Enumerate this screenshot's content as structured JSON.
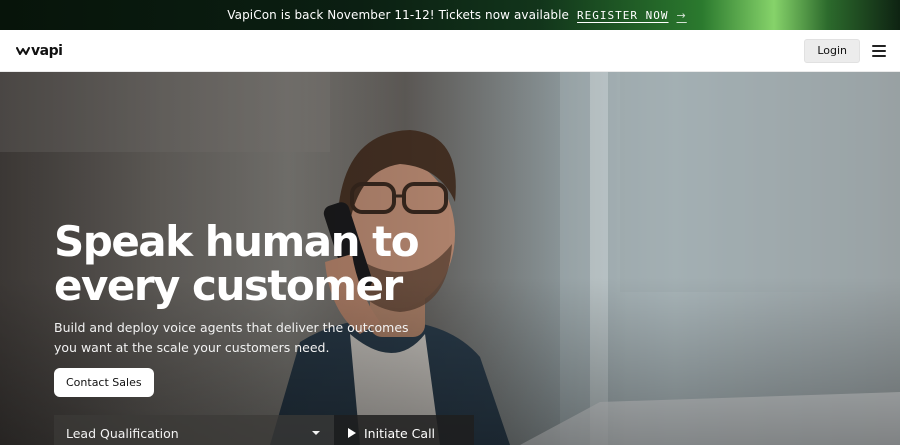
{
  "announcement": {
    "text": "VapiCon is back November 11-12! Tickets now available",
    "cta_label": "REGISTER NOW",
    "arrow_glyph": "→"
  },
  "header": {
    "logo_text": "vapi",
    "logo_icon": "vapi-wave-icon",
    "login_label": "Login",
    "menu_icon": "hamburger-menu-icon"
  },
  "hero": {
    "title_line1": "Speak human to",
    "title_line2": "every customer",
    "subtitle": "Build and deploy voice agents that deliver the outcomes you want at the scale your customers need.",
    "contact_label": "Contact Sales",
    "call_select_value": "Lead Qualification",
    "initiate_label": "Initiate Call"
  },
  "colors": {
    "accent_green": "#86d36a",
    "header_bg": "#ffffff",
    "login_bg": "#ececec",
    "text_dark": "#111111"
  }
}
